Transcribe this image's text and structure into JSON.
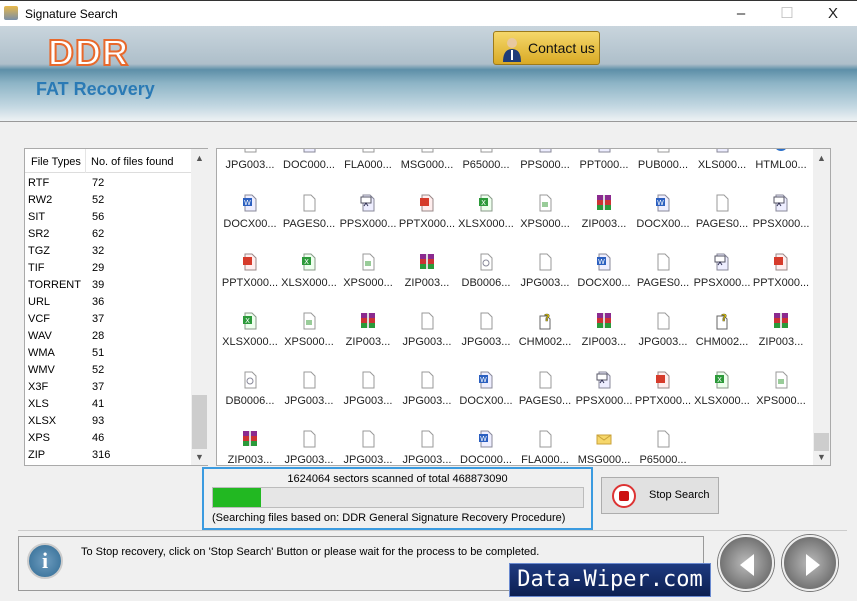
{
  "window": {
    "title": "Signature Search",
    "minimize": "–",
    "maximize": "☐",
    "close": "X"
  },
  "banner": {
    "logo": "DDR",
    "subtitle": "FAT Recovery",
    "contact_label": "Contact us"
  },
  "file_types": {
    "headers": [
      "File Types",
      "No. of files found"
    ],
    "rows": [
      [
        "RTF",
        "72"
      ],
      [
        "RW2",
        "52"
      ],
      [
        "SIT",
        "56"
      ],
      [
        "SR2",
        "62"
      ],
      [
        "TGZ",
        "32"
      ],
      [
        "TIF",
        "29"
      ],
      [
        "TORRENT",
        "39"
      ],
      [
        "URL",
        "36"
      ],
      [
        "VCF",
        "37"
      ],
      [
        "WAV",
        "28"
      ],
      [
        "WMA",
        "51"
      ],
      [
        "WMV",
        "52"
      ],
      [
        "X3F",
        "37"
      ],
      [
        "XLS",
        "41"
      ],
      [
        "XLSX",
        "93"
      ],
      [
        "XPS",
        "46"
      ],
      [
        "ZIP",
        "316"
      ]
    ]
  },
  "files": [
    [
      [
        "JPG003...",
        "blank"
      ],
      [
        "DOC000...",
        "word"
      ],
      [
        "FLA000...",
        "blank"
      ],
      [
        "MSG000...",
        "blank"
      ],
      [
        "P65000...",
        "blank"
      ],
      [
        "PPS000...",
        "pps"
      ],
      [
        "PPT000...",
        "word"
      ],
      [
        "PUB000...",
        "blank"
      ],
      [
        "XLS000...",
        "word"
      ],
      [
        "HTML00...",
        "html"
      ]
    ],
    [
      [
        "DOCX00...",
        "word"
      ],
      [
        "PAGES0...",
        "blank"
      ],
      [
        "PPSX000...",
        "pps"
      ],
      [
        "PPTX000...",
        "ppt"
      ],
      [
        "XLSX000...",
        "excel"
      ],
      [
        "XPS000...",
        "xps"
      ],
      [
        "ZIP003...",
        "zip"
      ],
      [
        "DOCX00...",
        "word"
      ],
      [
        "PAGES0...",
        "blank"
      ],
      [
        "PPSX000...",
        "pps"
      ]
    ],
    [
      [
        "PPTX000...",
        "ppt"
      ],
      [
        "XLSX000...",
        "excel"
      ],
      [
        "XPS000...",
        "xps"
      ],
      [
        "ZIP003...",
        "zip"
      ],
      [
        "DB0006...",
        "db"
      ],
      [
        "JPG003...",
        "blank"
      ],
      [
        "DOCX00...",
        "word"
      ],
      [
        "PAGES0...",
        "blank"
      ],
      [
        "PPSX000...",
        "pps"
      ],
      [
        "PPTX000...",
        "ppt"
      ]
    ],
    [
      [
        "XLSX000...",
        "excel"
      ],
      [
        "XPS000...",
        "xps"
      ],
      [
        "ZIP003...",
        "zip"
      ],
      [
        "JPG003...",
        "blank"
      ],
      [
        "JPG003...",
        "blank"
      ],
      [
        "CHM002...",
        "chm"
      ],
      [
        "ZIP003...",
        "zip"
      ],
      [
        "JPG003...",
        "blank"
      ],
      [
        "CHM002...",
        "chm"
      ],
      [
        "ZIP003...",
        "zip"
      ]
    ],
    [
      [
        "DB0006...",
        "db"
      ],
      [
        "JPG003...",
        "blank"
      ],
      [
        "JPG003...",
        "blank"
      ],
      [
        "JPG003...",
        "blank"
      ],
      [
        "DOCX00...",
        "word"
      ],
      [
        "PAGES0...",
        "blank"
      ],
      [
        "PPSX000...",
        "pps"
      ],
      [
        "PPTX000...",
        "ppt"
      ],
      [
        "XLSX000...",
        "excel"
      ],
      [
        "XPS000...",
        "xps"
      ]
    ],
    [
      [
        "ZIP003...",
        "zip"
      ],
      [
        "JPG003...",
        "blank"
      ],
      [
        "JPG003...",
        "blank"
      ],
      [
        "JPG003...",
        "blank"
      ],
      [
        "DOC000...",
        "word"
      ],
      [
        "FLA000...",
        "blank"
      ],
      [
        "MSG000...",
        "msg"
      ],
      [
        "P65000...",
        "blank"
      ]
    ]
  ],
  "progress": {
    "status": "1624064 sectors scanned of total 468873090",
    "percent": 13,
    "procedure": "(Searching files based on:  DDR General Signature Recovery Procedure)",
    "color": "#22b822"
  },
  "stop_label": "Stop Search",
  "info_message": "To Stop recovery, click on 'Stop Search' Button or please wait for the process to be completed.",
  "watermark": "Data-Wiper.com"
}
